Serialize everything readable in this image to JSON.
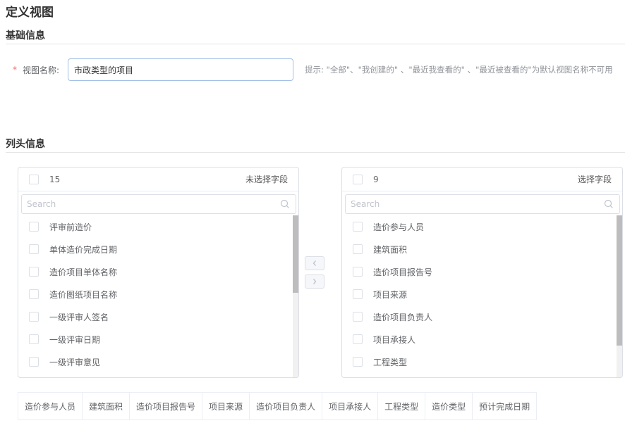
{
  "page": {
    "title": "定义视图"
  },
  "basic": {
    "section_title": "基础信息",
    "required_mark": "*",
    "name_label": "视图名称:",
    "name_value": "市政类型的项目",
    "hint": "提示: \"全部\"、\"我创建的\" 、\"最近我查看的\" 、\"最近被查看的\"为默认视图名称不可用"
  },
  "columns": {
    "section_title": "列头信息",
    "left_panel": {
      "count": "15",
      "caption": "未选择字段",
      "search_placeholder": "Search",
      "items": [
        "评审前造价",
        "单体造价完成日期",
        "造价项目单体名称",
        "造价图纸项目名称",
        "一级评审人签名",
        "一级评审日期",
        "一级评审意见"
      ]
    },
    "right_panel": {
      "count": "9",
      "caption": "选择字段",
      "search_placeholder": "Search",
      "items": [
        "造价参与人员",
        "建筑面积",
        "造价项目报告号",
        "项目来源",
        "造价项目负责人",
        "项目承接人",
        "工程类型"
      ]
    },
    "move_left_icon": "chevron-left-icon",
    "move_right_icon": "chevron-right-icon",
    "selected_columns": [
      "造价参与人员",
      "建筑面积",
      "造价项目报告号",
      "项目来源",
      "造价项目负责人",
      "项目承接人",
      "工程类型",
      "造价类型",
      "预计完成日期"
    ]
  }
}
